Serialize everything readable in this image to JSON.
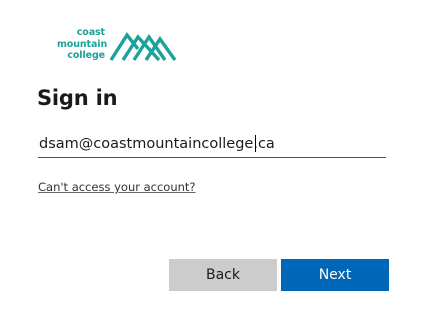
{
  "brand": {
    "logo_lines": [
      "coast",
      "mountain",
      "college"
    ],
    "logo_color": "#1aa39a",
    "logo_icon": "mountain-logo-icon"
  },
  "signin": {
    "title": "Sign in",
    "email_value": "dsam@coastmountaincollege.ca",
    "cant_access_label": "Can't access your account?"
  },
  "buttons": {
    "back_label": "Back",
    "next_label": "Next"
  },
  "colors": {
    "primary": "#0067b8",
    "secondary_button": "#cccccc",
    "text": "#1b1b1b"
  }
}
